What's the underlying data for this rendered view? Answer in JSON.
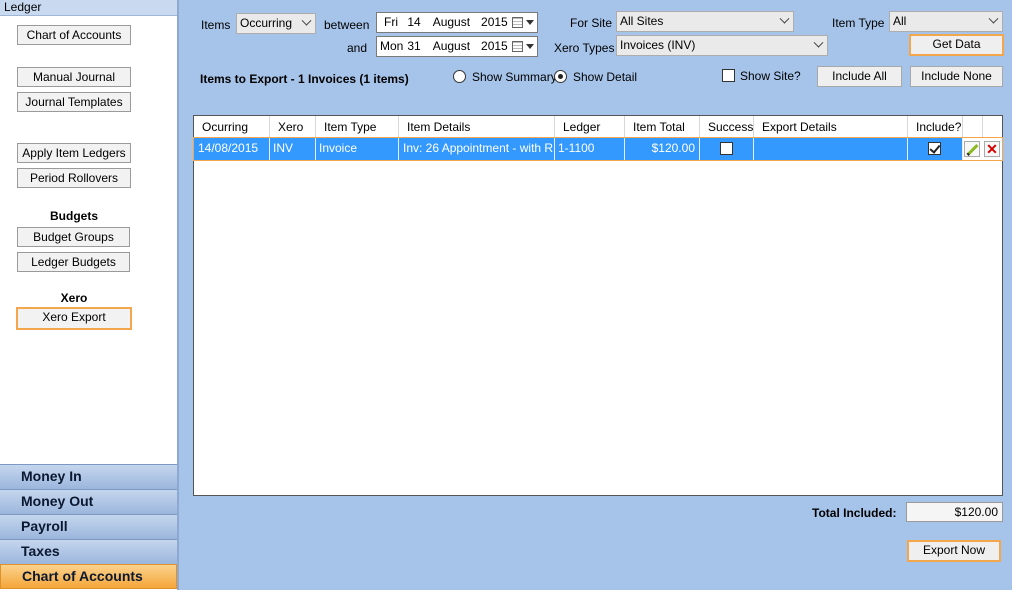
{
  "sidebar": {
    "header": "Ledger",
    "buttons": {
      "chart_of_accounts": "Chart of Accounts",
      "manual_journal": "Manual Journal",
      "journal_templates": "Journal Templates",
      "apply_item_ledgers": "Apply Item Ledgers",
      "period_rollovers": "Period Rollovers",
      "budget_groups": "Budget Groups",
      "ledger_budgets": "Ledger Budgets",
      "xero_export": "Xero Export"
    },
    "headings": {
      "budgets": "Budgets",
      "xero": "Xero"
    },
    "nav": [
      "Money In",
      "Money Out",
      "Payroll",
      "Taxes",
      "Chart of Accounts"
    ]
  },
  "filters": {
    "items_label": "Items",
    "items_value": "Occurring",
    "between_label": "between",
    "and_label": "and",
    "start_date": {
      "day": "Fri",
      "dd": "14",
      "month": "August",
      "year": "2015"
    },
    "end_date": {
      "day": "Mon",
      "dd": "31",
      "month": "August",
      "year": "2015"
    },
    "for_site_label": "For Site",
    "for_site_value": "All Sites",
    "xero_types_label": "Xero Types",
    "xero_types_value": "Invoices (INV)",
    "item_type_label": "Item Type",
    "item_type_value": "All",
    "get_data": "Get Data"
  },
  "export_bar": {
    "summary_text": "Items to Export - 1 Invoices (1 items)",
    "show_summary": "Show Summary",
    "show_detail": "Show Detail",
    "view_mode": "detail",
    "show_site": "Show Site?",
    "include_all": "Include All",
    "include_none": "Include None"
  },
  "grid": {
    "columns": [
      "Ocurring",
      "Xero",
      "Item Type",
      "Item Details",
      "Ledger",
      "Item Total",
      "Success",
      "Export Details",
      "Include?"
    ],
    "rows": [
      {
        "ocurring": "14/08/2015",
        "xero": "INV",
        "item_type": "Invoice",
        "item_details": "Inv: 26 Appointment - with R...",
        "ledger": "1-1100",
        "item_total": "$120.00",
        "success": false,
        "export_details": "",
        "include": true
      }
    ]
  },
  "footer": {
    "total_label": "Total Included:",
    "total_value": "$120.00",
    "export_now": "Export Now"
  },
  "colors": {
    "accent": "#f3a64b",
    "selection": "#3399ff",
    "panel_bg": "#a6c4ea"
  },
  "icons": {
    "edit": "pencil-icon",
    "delete": "close-icon"
  }
}
